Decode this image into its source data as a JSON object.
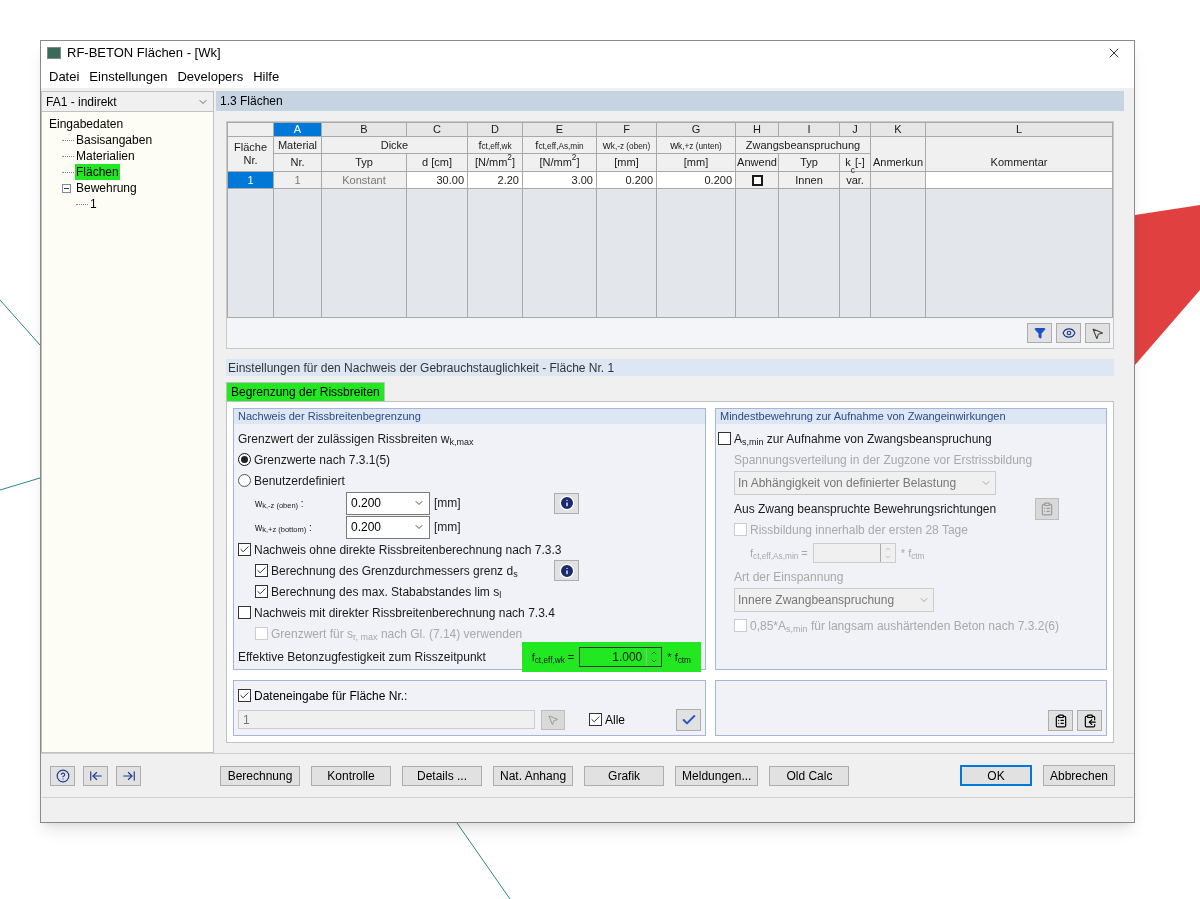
{
  "window": {
    "title": "RF-BETON Flächen - [Wk]"
  },
  "menu": [
    "Datei",
    "Einstellungen",
    "Developers",
    "Hilfe"
  ],
  "navigator": {
    "combo": "FA1 - indirekt",
    "tree": [
      {
        "label": "Eingabedaten",
        "selected": false,
        "children": [
          {
            "label": "Basisangaben",
            "selected": false
          },
          {
            "label": "Materialien",
            "selected": false
          },
          {
            "label": "Flächen",
            "selected": true
          },
          {
            "label": "Bewehrung",
            "selected": false,
            "expanded": true,
            "children": [
              {
                "label": "1",
                "selected": false
              }
            ]
          }
        ]
      }
    ]
  },
  "section_title": "1.3 Flächen",
  "table": {
    "row_header": "Fläche Nr.",
    "column_groups": [
      {
        "columns": [
          {
            "letter": "A",
            "selected": true,
            "header_top": "Material",
            "header_bottom": "Nr."
          }
        ]
      },
      {
        "label": "Dicke",
        "columns": [
          {
            "letter": "B",
            "selected": false,
            "header_bottom": "Typ"
          },
          {
            "letter": "C",
            "selected": false,
            "header_bottom": "d [cm]"
          }
        ]
      },
      {
        "columns": [
          {
            "letter": "D",
            "selected": false,
            "header_top": "f$_{ct,eff,wk}$",
            "header_bottom": "[N/mm$^{2}$]"
          }
        ]
      },
      {
        "columns": [
          {
            "letter": "E",
            "selected": false,
            "header_top": "f$_{ct,eff,As,min}$",
            "header_bottom": "[N/mm$^{2}$]"
          }
        ]
      },
      {
        "columns": [
          {
            "letter": "F",
            "selected": false,
            "header_top": "w$_{k,-z (oben)}$",
            "header_bottom": "[mm]"
          }
        ]
      },
      {
        "columns": [
          {
            "letter": "G",
            "selected": false,
            "header_top": "w$_{k,+z (unten)}$",
            "header_bottom": "[mm]"
          }
        ]
      },
      {
        "label": "Zwangsbeanspruchung",
        "columns": [
          {
            "letter": "H",
            "selected": false,
            "header_bottom": "Anwend"
          },
          {
            "letter": "I",
            "selected": false,
            "header_bottom": "Typ"
          },
          {
            "letter": "J",
            "selected": false,
            "header_bottom": "k$_{c}$ [-]"
          }
        ]
      },
      {
        "columns": [
          {
            "letter": "K",
            "selected": false,
            "header_bottom": "Anmerkun"
          }
        ]
      },
      {
        "columns": [
          {
            "letter": "L",
            "selected": false,
            "header_bottom": "Kommentar"
          }
        ]
      }
    ],
    "rows": [
      {
        "label": "1",
        "selected": true,
        "cells": [
          {
            "kind": "readonly",
            "value": "1"
          },
          {
            "kind": "readonly",
            "value": "Konstant"
          },
          {
            "kind": "number",
            "value": "30.00"
          },
          {
            "kind": "number",
            "value": "2.20"
          },
          {
            "kind": "number",
            "value": "3.00"
          },
          {
            "kind": "number",
            "value": "0.200"
          },
          {
            "kind": "number",
            "value": "0.200"
          },
          {
            "kind": "checkbox",
            "checked": false
          },
          {
            "kind": "text",
            "value": "Innen"
          },
          {
            "kind": "text",
            "value": "var."
          },
          {
            "kind": "empty"
          },
          {
            "kind": "blank"
          }
        ]
      }
    ]
  },
  "settings_title": "Einstellungen für den Nachweis der Gebrauchstauglichkeit - Fläche Nr. 1",
  "tabs": [
    {
      "label": "Begrenzung der Rissbreiten",
      "selected": true
    }
  ],
  "left_group": {
    "title": "Nachweis der Rissbreitenbegrenzung",
    "items": [
      {
        "kind": "text",
        "text": "Grenzwert der zulässigen Rissbreiten w$_{k,max}$",
        "disabled": false
      },
      {
        "kind": "radio",
        "label": "Grenzwerte nach 7.3.1(5)",
        "selected": true
      },
      {
        "kind": "radio",
        "label": "Benutzerdefiniert",
        "selected": false
      },
      {
        "kind": "dropdown",
        "label": "w$_{k,-z (oben)}$ :",
        "value": "0.200",
        "unit": "[mm]",
        "info": true
      },
      {
        "kind": "dropdown",
        "label": "w$_{k,+z (bottom)}$ :",
        "value": "0.200",
        "unit": "[mm]",
        "info": false
      },
      {
        "kind": "checkbox",
        "label": "Nachweis ohne direkte Rissbreitenberechnung nach 7.3.3",
        "checked": true,
        "disabled": false,
        "children": [
          {
            "kind": "checkbox",
            "label": "Berechnung des Grenzdurchmessers  grenz d$_{s}$",
            "checked": true,
            "disabled": false,
            "info": true
          },
          {
            "kind": "checkbox",
            "label": "Berechnung des max. Stababstandes lim s$_{l}$",
            "checked": true,
            "disabled": false
          }
        ]
      },
      {
        "kind": "checkbox",
        "label": "Nachweis mit direkter Rissbreitenberechnung nach 7.3.4",
        "checked": false,
        "disabled": false,
        "children": [
          {
            "kind": "checkbox",
            "label": "Grenzwert für s$_{r, max}$ nach Gl. (7.14) verwenden",
            "checked": false,
            "disabled": true
          }
        ]
      },
      {
        "kind": "spin",
        "text": "Effektive Betonzugfestigkeit zum Risszeitpunkt",
        "label": "f$_{ct,eff,wk}$ =",
        "value": "1.000",
        "unit": "* f$_{ctm}$",
        "highlighted": true,
        "disabled": false
      }
    ]
  },
  "data_entry": {
    "label": "Dateneingabe für Fläche Nr.:",
    "checked": true,
    "value": "1",
    "disabled": true,
    "all_label": "Alle",
    "all_checked": true
  },
  "right_group": {
    "title": "Mindestbewehrung zur Aufnahme von Zwangeinwirkungen",
    "items": [
      {
        "kind": "checkbox",
        "label": "A$_{s,min}$ zur Aufnahme von Zwangsbeanspruchung",
        "checked": false,
        "disabled": false
      },
      {
        "kind": "text",
        "text": "Spannungsverteilung in der Zugzone vor Erstrissbildung",
        "disabled": true
      },
      {
        "kind": "select",
        "value": "In Abhängigkeit von definierter Belastung",
        "disabled": true
      },
      {
        "kind": "text",
        "text": "Aus Zwang beanspruchte Bewehrungsrichtungen",
        "disabled": false,
        "button": true
      },
      {
        "kind": "checkbox",
        "label": "Rissbildung innerhalb der ersten 28 Tage",
        "checked": false,
        "disabled": true
      },
      {
        "kind": "spin",
        "label": "f$_{ct,eff,As,min}$ =",
        "unit": "* f$_{ctm}$",
        "highlighted": false,
        "disabled": true
      },
      {
        "kind": "text",
        "text": "Art der Einspannung",
        "disabled": true
      },
      {
        "kind": "select",
        "value": "Innere Zwangbeanspruchung",
        "disabled": true
      },
      {
        "kind": "checkbox",
        "label": "0,85*A$_{s,min}$ für langsam aushärtenden Beton nach 7.3.2(6)",
        "checked": false,
        "disabled": true
      }
    ]
  },
  "footer_buttons": [
    {
      "label": "Berechnung"
    },
    {
      "label": "Kontrolle"
    },
    {
      "label": "Details ..."
    },
    {
      "label": "Nat. Anhang"
    },
    {
      "label": "Grafik"
    },
    {
      "label": "Meldungen..."
    },
    {
      "label": "Old Calc"
    }
  ],
  "dialog_buttons": [
    {
      "label": "OK",
      "default": true
    },
    {
      "label": "Abbrechen",
      "default": false
    }
  ]
}
